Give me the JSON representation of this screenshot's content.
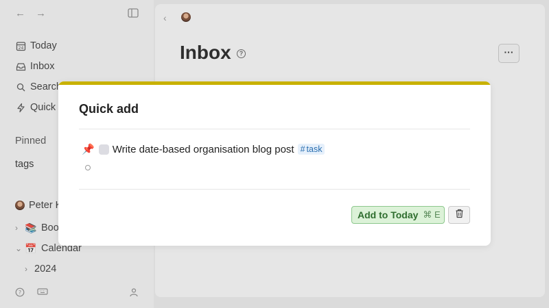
{
  "sidebar": {
    "nav": {
      "today": "Today",
      "inbox": "Inbox",
      "search": "Search",
      "quick": "Quick"
    },
    "pinned_title": "Pinned",
    "pinned_item": "tags",
    "user": "Peter K",
    "tree": {
      "books": "Books",
      "calendar": "Calendar",
      "year": "2024"
    }
  },
  "main": {
    "title": "Inbox",
    "more_label": "···"
  },
  "modal": {
    "title": "Quick add",
    "task_text": "Write date-based organisation blog post",
    "tag_hash": "#",
    "tag_text": "task",
    "add_button_label": "Add to Today",
    "shortcut": "⌘ E"
  },
  "colors": {
    "accent": "#c8b100",
    "today_button_bg": "#dcf2d8",
    "tag_bg": "#e6f0fb"
  }
}
